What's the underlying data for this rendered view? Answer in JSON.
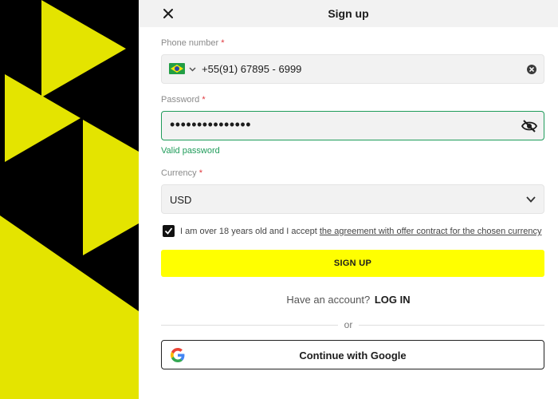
{
  "colors": {
    "brand_yellow": "#ffff00",
    "art_yellow": "#e4e400",
    "art_black": "#000000",
    "valid_green": "#1f9c5a",
    "required_red": "#e0383e"
  },
  "header": {
    "title": "Sign up",
    "close_icon": "close-icon"
  },
  "phone": {
    "label": "Phone number",
    "required_mark": "*",
    "country_flag": "brazil-flag-icon",
    "value": "+55(91) 67895 - 6999",
    "clear_icon": "clear-icon"
  },
  "password": {
    "label": "Password",
    "required_mark": "*",
    "value": "•••••••••••••••",
    "toggle_icon": "eye-off-icon",
    "valid_message": "Valid password"
  },
  "currency": {
    "label": "Currency",
    "required_mark": "*",
    "selected": "USD"
  },
  "terms": {
    "checked": true,
    "text": "I am over 18 years old and I accept ",
    "link": "the agreement with offer contract for the chosen currency"
  },
  "signup_button": "SIGN UP",
  "login": {
    "prompt": "Have an account?",
    "link": "LOG IN"
  },
  "divider_text": "or",
  "google": {
    "icon": "google-icon",
    "label": "Continue with Google"
  }
}
